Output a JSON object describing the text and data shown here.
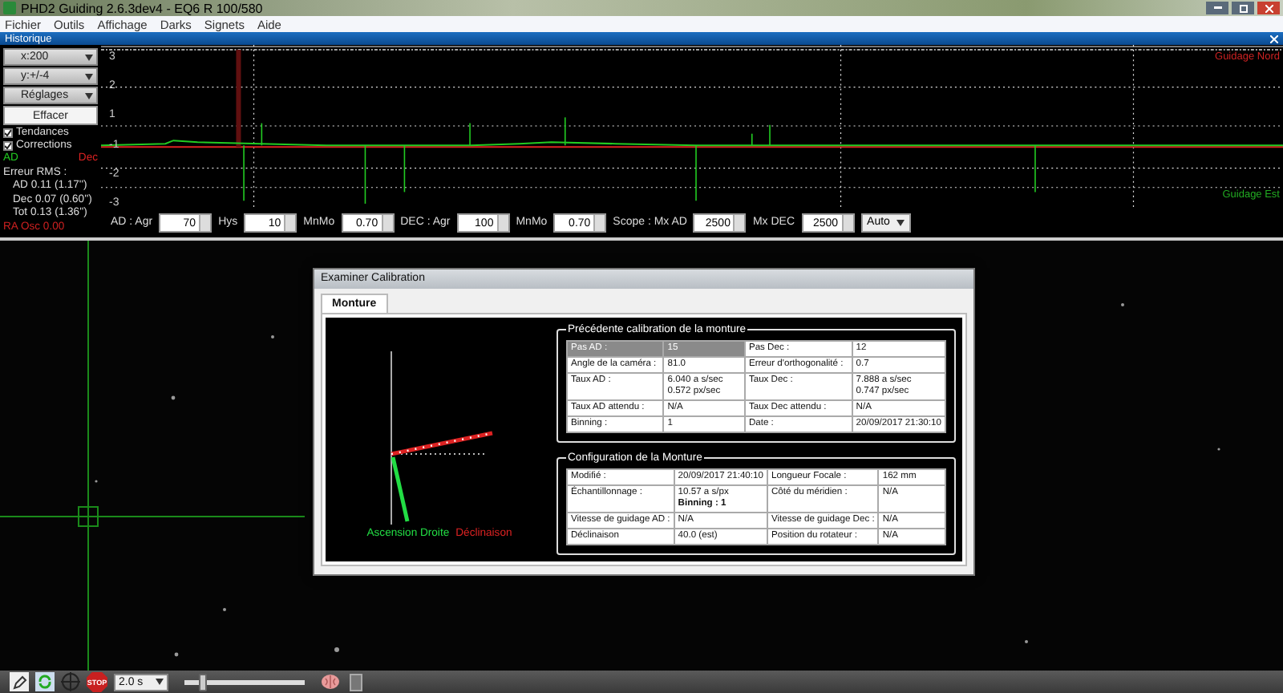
{
  "window": {
    "title": "PHD2 Guiding 2.6.3dev4 - EQ6 R 100/580"
  },
  "menu": [
    "Fichier",
    "Outils",
    "Affichage",
    "Darks",
    "Signets",
    "Aide"
  ],
  "graph_panel": {
    "title": "Historique",
    "x_scale": "x:200",
    "y_scale": "y:+/-4",
    "settings_button": "Réglages",
    "clear_button": "Effacer",
    "checkboxes": [
      {
        "label": "Tendances",
        "checked": true
      },
      {
        "label": "Corrections",
        "checked": true
      }
    ],
    "legend": [
      {
        "label": "AD",
        "color": "#22cc22"
      },
      {
        "label": "Dec",
        "color": "#dd2222"
      }
    ],
    "rms_title": "Erreur RMS :",
    "rms": [
      "AD 0.11 (1.17'')",
      "Dec 0.07 (0.60'')",
      "Tot 0.13 (1.36'')"
    ],
    "ra_osc": "RA Osc 0.00",
    "y_ticks": [
      "3",
      "2",
      "1",
      "-1",
      "-2",
      "-3"
    ],
    "direction_labels": [
      {
        "label": "Guidage Nord",
        "color": "#cc2222"
      },
      {
        "label": "Guidage Est",
        "color": "#22aa22"
      }
    ],
    "params": [
      {
        "kind": "spin",
        "label": "AD : Agr",
        "value": "70"
      },
      {
        "kind": "spin",
        "label": "Hys",
        "value": "10"
      },
      {
        "kind": "spin",
        "label": "MnMo",
        "value": "0.70"
      },
      {
        "kind": "spin",
        "label": "DEC : Agr",
        "value": "100"
      },
      {
        "kind": "spin",
        "label": "MnMo",
        "value": "0.70"
      },
      {
        "kind": "spin",
        "label": "Scope : Mx AD",
        "value": "2500"
      },
      {
        "kind": "spin",
        "label": "Mx DEC",
        "value": "2500"
      },
      {
        "kind": "select",
        "value": "Auto"
      }
    ]
  },
  "dialog": {
    "title": "Examiner Calibration",
    "tabs": [
      {
        "label": "Monture",
        "selected": true
      }
    ],
    "plot_legend": [
      {
        "label": "Ascension Droite",
        "color": "#22dd44"
      },
      {
        "label": "Déclinaison",
        "color": "#dd2222"
      }
    ],
    "groups": [
      {
        "title": "Précédente calibration de la monture",
        "rows": [
          {
            "selected": true,
            "cells": [
              [
                "Pas AD :"
              ],
              [
                "15"
              ],
              [
                "Pas Dec :"
              ],
              [
                "12"
              ]
            ]
          },
          {
            "selected": false,
            "cells": [
              [
                "Angle de la caméra :"
              ],
              [
                "81.0"
              ],
              [
                "Erreur d'orthogonalité :"
              ],
              [
                "0.7"
              ]
            ]
          },
          {
            "selected": false,
            "cells": [
              [
                "Taux AD :"
              ],
              [
                "6.040 a s/sec",
                "0.572 px/sec"
              ],
              [
                "Taux Dec :"
              ],
              [
                "7.888 a s/sec",
                "0.747 px/sec"
              ]
            ]
          },
          {
            "selected": false,
            "cells": [
              [
                "Taux AD attendu :"
              ],
              [
                "N/A"
              ],
              [
                "Taux Dec attendu :"
              ],
              [
                "N/A"
              ]
            ]
          },
          {
            "selected": false,
            "cells": [
              [
                "Binning :"
              ],
              [
                "1"
              ],
              [
                "Date :"
              ],
              [
                "20/09/2017 21:30:10"
              ]
            ]
          }
        ]
      },
      {
        "title": "Configuration de la Monture",
        "rows": [
          {
            "selected": false,
            "cells": [
              [
                "Modifié :"
              ],
              [
                "20/09/2017 21:40:10"
              ],
              [
                "Longueur Focale :"
              ],
              [
                "162 mm"
              ]
            ]
          },
          {
            "selected": false,
            "cells": [
              [
                "Échantillonnage :"
              ],
              [
                "10.57 a s/px",
                "**Binning : 1**"
              ],
              [
                "Côté du méridien :"
              ],
              [
                "N/A"
              ]
            ]
          },
          {
            "selected": false,
            "cells": [
              [
                "Vitesse de guidage AD :"
              ],
              [
                "N/A"
              ],
              [
                "Vitesse de guidage Dec :"
              ],
              [
                "N/A"
              ]
            ]
          },
          {
            "selected": false,
            "cells": [
              [
                "Déclinaison"
              ],
              [
                "40.0 (est)"
              ],
              [
                "Position du rotateur :"
              ],
              [
                "N/A"
              ]
            ]
          }
        ]
      }
    ]
  },
  "toolbar": {
    "stop_label": "STOP",
    "exposure": "2.0 s",
    "slider": {
      "level": 0.15
    }
  }
}
